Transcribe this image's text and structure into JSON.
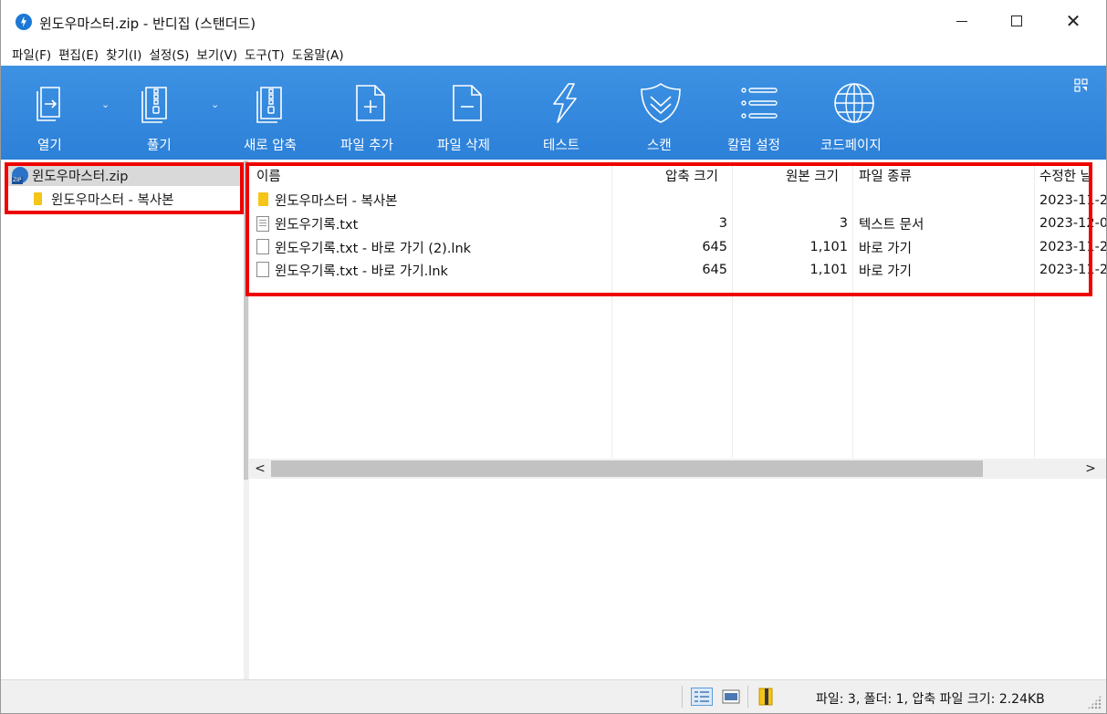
{
  "window": {
    "title": "윈도우마스터.zip - 반디집 (스탠더드)",
    "minimize_glyph": "—",
    "close_glyph": "✕"
  },
  "menu": {
    "items": [
      "파일(F)",
      "편집(E)",
      "찾기(I)",
      "설정(S)",
      "보기(V)",
      "도구(T)",
      "도움말(A)"
    ]
  },
  "toolbar": {
    "buttons": [
      {
        "label": "열기",
        "icon": "open-icon",
        "has_dropdown": true
      },
      {
        "label": "풀기",
        "icon": "extract-icon",
        "has_dropdown": true
      },
      {
        "label": "새로 압축",
        "icon": "new-archive-icon",
        "has_dropdown": false
      },
      {
        "label": "파일 추가",
        "icon": "add-file-icon",
        "has_dropdown": false
      },
      {
        "label": "파일 삭제",
        "icon": "delete-file-icon",
        "has_dropdown": false
      },
      {
        "label": "테스트",
        "icon": "test-icon",
        "has_dropdown": false
      },
      {
        "label": "스캔",
        "icon": "scan-shield-icon",
        "has_dropdown": false
      },
      {
        "label": "칼럼 설정",
        "icon": "column-settings-icon",
        "has_dropdown": false
      },
      {
        "label": "코드페이지",
        "icon": "codepage-globe-icon",
        "has_dropdown": false
      }
    ],
    "dropdown_glyph": "⌄"
  },
  "tree": {
    "root": "윈도우마스터.zip",
    "child": "윈도우마스터 - 복사본"
  },
  "list": {
    "columns": {
      "name": "이름",
      "compressed": "압축 크기",
      "original": "원본 크기",
      "type": "파일 종류",
      "modified": "수정한 날"
    },
    "rows": [
      {
        "name": "윈도우마스터 - 복사본",
        "compressed": "",
        "original": "",
        "type": "",
        "modified": "2023-11-2",
        "icon": "folder-icon"
      },
      {
        "name": "윈도우기록.txt",
        "compressed": "3",
        "original": "3",
        "type": "텍스트 문서",
        "modified": "2023-12-0",
        "icon": "text-file-icon"
      },
      {
        "name": "윈도우기록.txt - 바로 가기 (2).lnk",
        "compressed": "645",
        "original": "1,101",
        "type": "바로 가기",
        "modified": "2023-11-2",
        "icon": "file-icon"
      },
      {
        "name": "윈도우기록.txt - 바로 가기.lnk",
        "compressed": "645",
        "original": "1,101",
        "type": "바로 가기",
        "modified": "2023-11-2",
        "icon": "file-icon"
      }
    ]
  },
  "scrollbar": {
    "left": "<",
    "right": ">"
  },
  "status": {
    "text": "파일: 3, 폴더: 1, 압축 파일 크기: 2.24KB"
  },
  "colors": {
    "toolbar": "#2c80d8",
    "highlight": "#ee0000",
    "folder": "#f5c518"
  }
}
